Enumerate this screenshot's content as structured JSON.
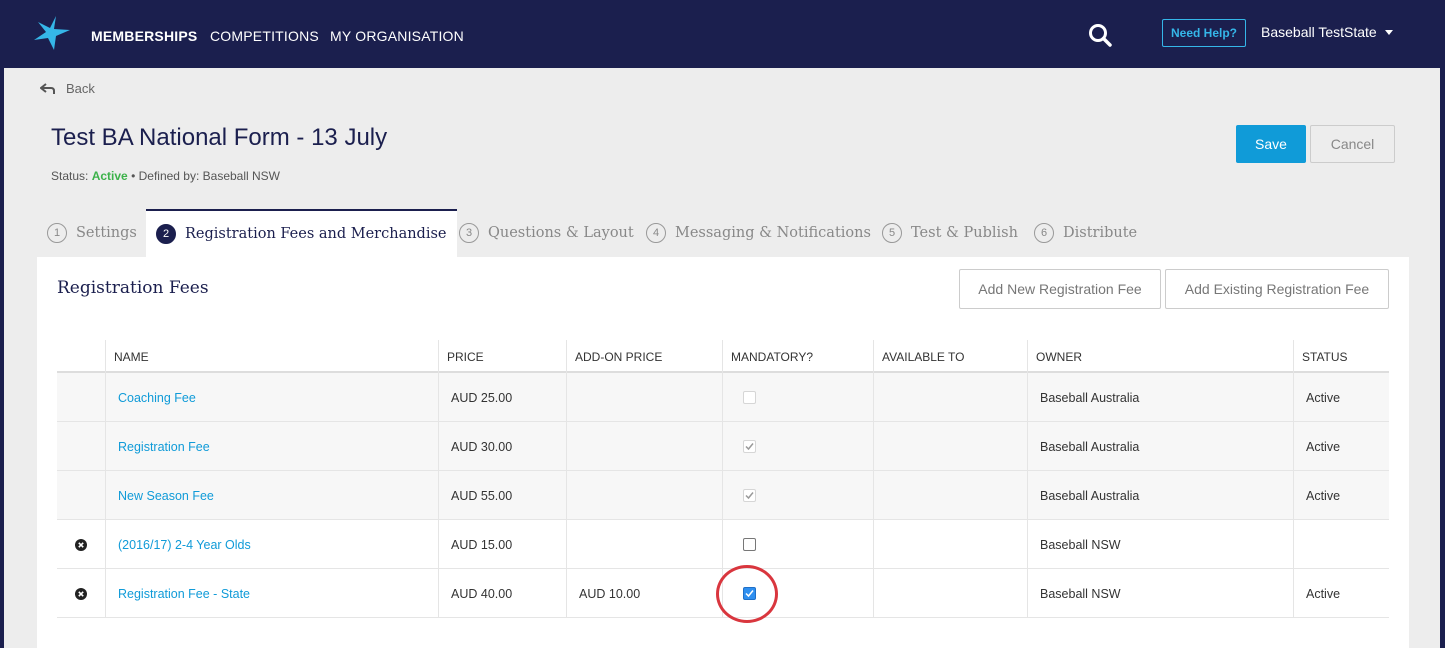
{
  "nav": {
    "items": [
      "MEMBERSHIPS",
      "COMPETITIONS",
      "MY ORGANISATION"
    ],
    "help_label": "Need Help?",
    "user_label": "Baseball TestState"
  },
  "page": {
    "back_label": "Back",
    "title": "Test BA National Form - 13 July",
    "status_prefix": "Status:",
    "status_value": "Active",
    "defined_by": "• Defined by: Baseball NSW",
    "save_label": "Save",
    "cancel_label": "Cancel"
  },
  "tabs": [
    {
      "num": "1",
      "label": "Settings"
    },
    {
      "num": "2",
      "label": "Registration Fees and Merchandise"
    },
    {
      "num": "3",
      "label": "Questions & Layout"
    },
    {
      "num": "4",
      "label": "Messaging & Notifications"
    },
    {
      "num": "5",
      "label": "Test & Publish"
    },
    {
      "num": "6",
      "label": "Distribute"
    }
  ],
  "panel": {
    "title": "Registration Fees",
    "add_new_label": "Add New Registration Fee",
    "add_existing_label": "Add Existing Registration Fee"
  },
  "table": {
    "headers": [
      "NAME",
      "PRICE",
      "ADD-ON PRICE",
      "MANDATORY?",
      "AVAILABLE TO",
      "OWNER",
      "STATUS"
    ],
    "rows": [
      {
        "name": "Coaching Fee",
        "price": "AUD 25.00",
        "addon": "",
        "mandatory": false,
        "available": "",
        "owner": "Baseball Australia",
        "status": "Active",
        "removable": false
      },
      {
        "name": "Registration Fee",
        "price": "AUD 30.00",
        "addon": "",
        "mandatory": true,
        "available": "",
        "owner": "Baseball Australia",
        "status": "Active",
        "removable": false
      },
      {
        "name": "New Season Fee",
        "price": "AUD 55.00",
        "addon": "",
        "mandatory": true,
        "available": "",
        "owner": "Baseball Australia",
        "status": "Active",
        "removable": false
      },
      {
        "name": "(2016/17) 2-4 Year Olds",
        "price": "AUD 15.00",
        "addon": "",
        "mandatory": false,
        "available": "",
        "owner": "Baseball NSW",
        "status": "",
        "removable": true
      },
      {
        "name": "Registration Fee - State",
        "price": "AUD 40.00",
        "addon": "AUD 10.00",
        "mandatory": true,
        "available": "",
        "owner": "Baseball NSW",
        "status": "Active",
        "removable": true
      }
    ]
  },
  "colors": {
    "brand_navy": "#1b1f4e",
    "accent_blue": "#109bd8",
    "active_green": "#3cb24a",
    "highlight_red": "#d9363e"
  }
}
